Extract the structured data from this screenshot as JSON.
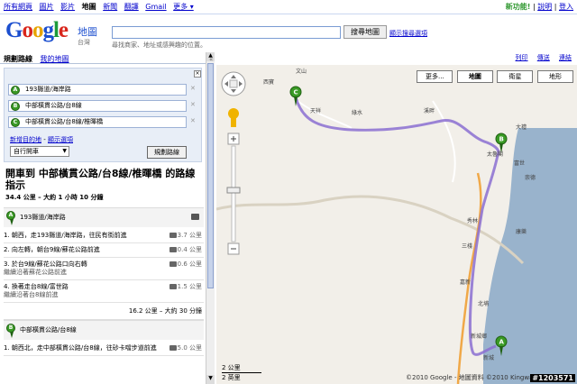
{
  "topnav": {
    "links": [
      "所有網頁",
      "圖片",
      "影片",
      "地圖",
      "新聞",
      "翻譯",
      "Gmail",
      "更多 ▾"
    ],
    "current": "地圖",
    "right_new": "新功能!",
    "right_help": "說明",
    "right_login": "登入"
  },
  "logo": {
    "text": "Google",
    "product": "地圖",
    "region": "台灣"
  },
  "search": {
    "value": "",
    "button": "搜尋地圖",
    "options_link": "顯示搜尋選項",
    "hint": "尋找商家、地址或感興趣的位置。"
  },
  "sidebar": {
    "tab_active": "規劃路線",
    "tab_other": "我的地圖",
    "waypoints": [
      {
        "marker": "A",
        "value": "193縣道/海岸路"
      },
      {
        "marker": "B",
        "value": "中部橫貫公路/台8線"
      },
      {
        "marker": "C",
        "value": "中部橫貫公路/台8線/椎暉橋"
      }
    ],
    "add_destination": "新增目的地",
    "show_options": "顯示選項",
    "mode": "自行開車",
    "plan_button": "規劃路線",
    "close": "×"
  },
  "directions": {
    "title": "開車到 中部橫貫公路/台8線/椎暉橋 的路線指示",
    "summary": "34.4 公里 – 大約 1 小時 10 分鐘",
    "start": {
      "marker": "A",
      "label": "193縣道/海岸路"
    },
    "steps": [
      {
        "text": "1. 朝西，走193縣道/海岸路，往民有街前進",
        "sub": "",
        "dist": "3.7 公里"
      },
      {
        "text": "2. 向左轉，朝台9線/蘇花公路前進",
        "sub": "",
        "dist": "0.4 公里"
      },
      {
        "text": "3. 於台9線/蘇花公路口向右轉",
        "sub": "繼續沿著蘇花公路前進",
        "dist": "10.6 公里"
      },
      {
        "text": "4. 換著走台8線/富世路",
        "sub": "繼續沿著台8線前進",
        "dist": "1.5 公里"
      }
    ],
    "segment_summary": "16.2 公里 – 大約 30 分鐘",
    "waypoint_b": {
      "marker": "B",
      "label": "中部橫貫公路/台8線"
    },
    "steps2": [
      {
        "text": "1. 朝西北，走中部橫貫公路/台8線，往砂卡噹步道前進",
        "sub": "",
        "dist": "15.0 公里"
      }
    ]
  },
  "map_toolbar": {
    "print": "列印",
    "send": "傳送",
    "link": "連結"
  },
  "map": {
    "more_button": "更多...",
    "types": [
      "地圖",
      "衛星",
      "地形"
    ],
    "active_type": "地圖",
    "scale_km": "2 公里",
    "scale_mi": "2 英里",
    "copyright": "©2010 Google - 地圖資料 ©2010 Kingway",
    "watermark": "#1203571",
    "place_labels": [
      "文山",
      "西寶",
      "綠水",
      "天祥",
      "溪畔",
      "太魯閣",
      "大禮",
      "富世",
      "崇德",
      "秀林",
      "三棧",
      "康樂",
      "新城鄉",
      "北埔",
      "嘉新",
      "新城"
    ],
    "markers": [
      "A",
      "B",
      "C"
    ],
    "route_color": "#8b6fd1",
    "sea_color": "#99b3cc",
    "land_color": "#f2efe9"
  }
}
